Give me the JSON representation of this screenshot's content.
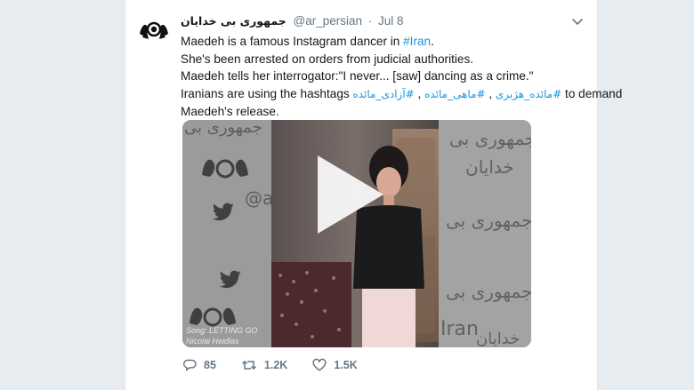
{
  "tweet": {
    "display_name": "جمهوری بی خدایان",
    "handle": "@ar_persian",
    "separator": "·",
    "date": "Jul 8",
    "text": {
      "line1_prefix": "Maedeh is a famous Instagram dancer in ",
      "line1_link": "#Iran",
      "line1_suffix": ".",
      "line2": "She's been arrested on orders from judicial authorities.",
      "line3": "Maedeh tells her interrogator:\"I never... [saw] dancing as a crime.\"",
      "line4_prefix": "Iranians are using the hashtags ",
      "hashtag1": "#آزادی_مائده",
      "comma1": " , ",
      "hashtag2": "#ماهی_مائده",
      "comma2": " , ",
      "hashtag3": "#مائده_هژبری",
      "line4_suffix": " to demand",
      "line5": "Maedeh's release."
    },
    "avatar_caption": "جمهوری بی خدایان",
    "video": {
      "caption_song": "Song: LETTING GO",
      "caption_artist": "Nicolai Heidlas",
      "watermark_right": [
        "جمهوری بی",
        "خدایان",
        "جمهوری بی",
        "جمهوری بی",
        "Iran",
        "خدایان"
      ],
      "watermark_left": [
        "جمهوری بی",
        "@a"
      ]
    },
    "actions": {
      "replies": "85",
      "retweets": "1.2K",
      "likes": "1.5K"
    }
  },
  "colors": {
    "background": "#e6ecf0",
    "link": "#1b95e0",
    "text": "#14171a",
    "muted": "#657786"
  },
  "icons": [
    "chevron-down-icon",
    "play-icon",
    "reply-icon",
    "retweet-icon",
    "like-icon",
    "twitter-bird-icon"
  ]
}
